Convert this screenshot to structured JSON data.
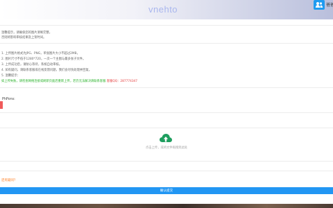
{
  "header": {
    "logo_text": "vnehto",
    "user_icon": "user-group-icon",
    "user_label": "爸爸"
  },
  "notes": {
    "line1": "温馨提示，请确保您的图片清晰完整，",
    "line2": "否则将影响审核结果及上架时间。",
    "line3": "1. 上传图片格式为JPG、PNG，单张图片大小不超过2MB，",
    "line4": "2. 图片尺寸不低于1280*720，一次一个主图与最多张子文件。",
    "line5": "3. 上传成功后，请耐心等待，系统自动审核。",
    "line6": "4. 如有疑问，请联系客服或在线反馈问题，我们会尽快处理并回复。",
    "line7": "5. 温馨提示：",
    "green_text": "如上传失败，请检查网络连接或刷新页面后重新上传，若仍无法解决请联系客服",
    "green_red_text": "客服QQ：287774347"
  },
  "field": {
    "label": "PhPons:"
  },
  "upload": {
    "icon": "cloud-upload-icon",
    "hint": "点击上传，或将文件拖拽到此处"
  },
  "footer": {
    "orange_link": "还有疑问？",
    "confirm_label": "确认提交"
  },
  "colors": {
    "accent": "#2196f3",
    "green": "#29b22a",
    "orange": "#ff7a1a",
    "marker": "#f05a5a",
    "upload_icon": "#1f9e5f"
  }
}
